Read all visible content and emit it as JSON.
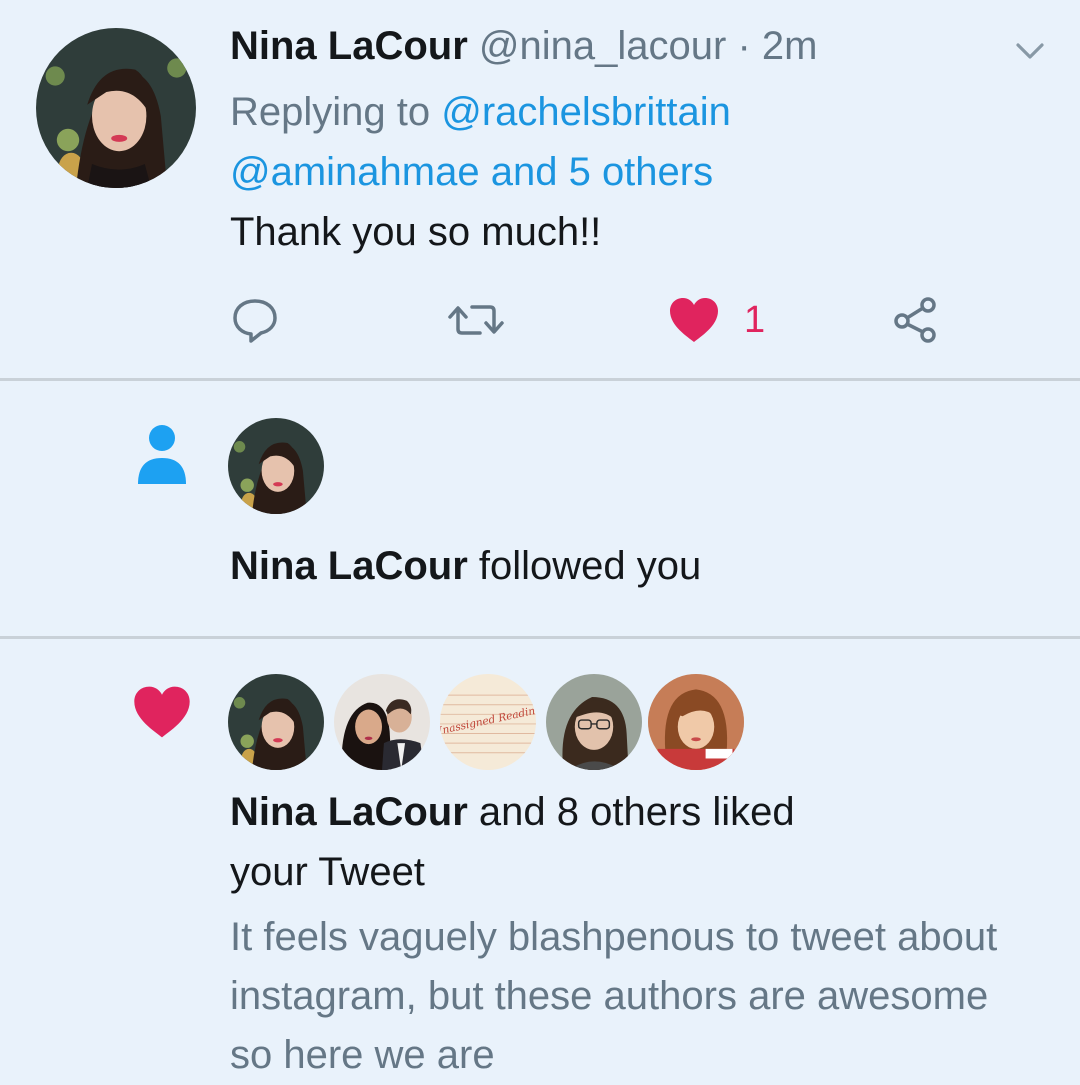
{
  "tweet": {
    "author_name": "Nina LaCour",
    "author_handle": "@nina_lacour",
    "separator": " · ",
    "time": "2m",
    "replying_prefix": "Replying to ",
    "reply_mention_1": "@rachelsbrittain",
    "reply_mention_2": "@aminahmae",
    "reply_and": " and ",
    "reply_others": "5 others",
    "text": "Thank you so much!!",
    "like_count": "1",
    "icons": [
      "reply-icon",
      "retweet-icon",
      "heart-icon-liked",
      "share-icon",
      "chevron-down-icon"
    ]
  },
  "follow_notification": {
    "name": "Nina LaCour",
    "action": " followed you",
    "icon": "person-icon"
  },
  "like_notification": {
    "name": "Nina LaCour",
    "action_line1": " and 8 others liked",
    "action_line2": "your Tweet",
    "quoted_text": "It feels vaguely blashpenous to tweet about instagram, but these authors are awesome so here we are",
    "icon": "heart-icon",
    "avatar_3_text": "Unassigned Reading"
  },
  "colors": {
    "background": "#e9f2fb",
    "link": "#1b95e0",
    "like": "#e0245e",
    "secondary_text": "#657786",
    "divider": "#c9d1d8"
  }
}
